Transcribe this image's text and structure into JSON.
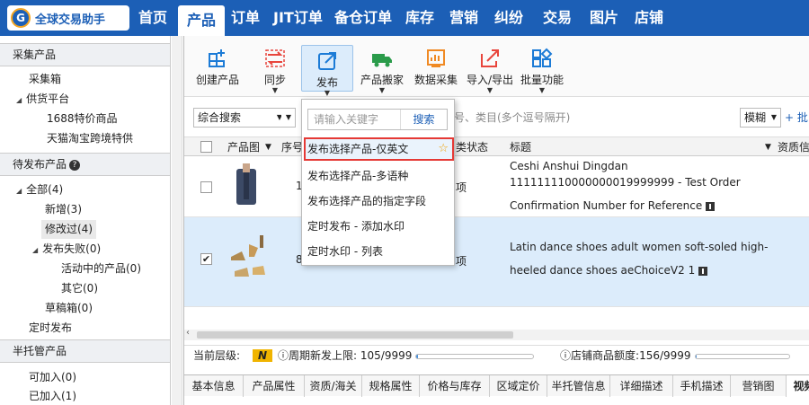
{
  "app": {
    "logo_text": "全球交易助手",
    "logo_badge": "G"
  },
  "nav": [
    {
      "label": "首页",
      "active": false
    },
    {
      "label": "产品",
      "active": true
    },
    {
      "label": "订单",
      "active": false
    },
    {
      "label": "JIT订单",
      "active": false
    },
    {
      "label": "备仓订单",
      "active": false
    },
    {
      "label": "库存",
      "active": false
    },
    {
      "label": "营销",
      "active": false
    },
    {
      "label": "纠纷",
      "active": false
    },
    {
      "label": "交易",
      "active": false
    },
    {
      "label": "图片",
      "active": false
    },
    {
      "label": "店铺",
      "active": false
    }
  ],
  "sidebar": {
    "collect_section": "采集产品",
    "collect_items": [
      "采集箱",
      "供货平台",
      "1688特价商品",
      "天猫淘宝跨境特供"
    ],
    "pending_section": "待发布产品",
    "pending_items": [
      "全部(4)",
      "新增(3)",
      "修改过(4)",
      "发布失败(0)",
      "活动中的产品(0)",
      "其它(0)",
      "草稿箱(0)",
      "定时发布"
    ],
    "semi_section": "半托管产品",
    "semi_items": [
      "可加入(0)",
      "已加入(1)"
    ]
  },
  "toolbar": [
    {
      "label": "创建产品",
      "icon": "plus-grid-icon",
      "dropdown": false
    },
    {
      "label": "同步",
      "icon": "sync-icon",
      "dropdown": true
    },
    {
      "label": "发布",
      "icon": "publish-icon",
      "dropdown": true
    },
    {
      "label": "产品搬家",
      "icon": "truck-icon",
      "dropdown": true
    },
    {
      "label": "数据采集",
      "icon": "data-collect-icon",
      "dropdown": false
    },
    {
      "label": "导入/导出",
      "icon": "import-export-icon",
      "dropdown": true
    },
    {
      "label": "批量功能",
      "icon": "batch-icon",
      "dropdown": true
    }
  ],
  "filter": {
    "search_type": "综合搜索",
    "second_select": "",
    "keyword_placeholder": "品型号、类目(多个逗号隔开)",
    "match": "模糊",
    "batch_link": "批"
  },
  "grid": {
    "headers": {
      "image": "产品图",
      "index": "序号",
      "status": "类状态",
      "title": "标题",
      "extra": "资质信"
    },
    "rows": [
      {
        "checked": false,
        "index": "1",
        "status": "项",
        "title_lines": [
          "Ceshi Anshui Dingdan",
          "111111110000000019999999 - Test Order",
          "Confirmation Number for Reference"
        ]
      },
      {
        "checked": true,
        "index": "8",
        "status": "项",
        "title_lines": [
          "Latin dance shoes adult women soft-soled high-",
          "heeled dance shoes aeChoiceV2 1"
        ]
      }
    ]
  },
  "publish_menu": {
    "search_placeholder": "请输入关键字",
    "search_button": "搜索",
    "items": [
      "发布选择产品-仅英文",
      "发布选择产品-多语种",
      "发布选择产品的指定字段",
      "定时发布 - 添加水印",
      "定时水印 - 列表"
    ]
  },
  "status": {
    "level_label": "当前层级:",
    "level_value": "N",
    "period_label": "周期新发上限:",
    "period_value": "105/9999",
    "period_progress": 0.0105,
    "store_label": "店铺商品额度:",
    "store_value": "156/9999",
    "store_progress": 0.0156
  },
  "tabs": [
    "基本信息",
    "产品属性",
    "资质/海关",
    "规格属性",
    "价格与库存",
    "区域定价",
    "半托管信息",
    "详细描述",
    "手机描述",
    "营销图",
    "视频"
  ],
  "colors": {
    "brand": "#1c5fb6",
    "highlight_border": "#e53935",
    "level_badge": "#f0b400"
  }
}
